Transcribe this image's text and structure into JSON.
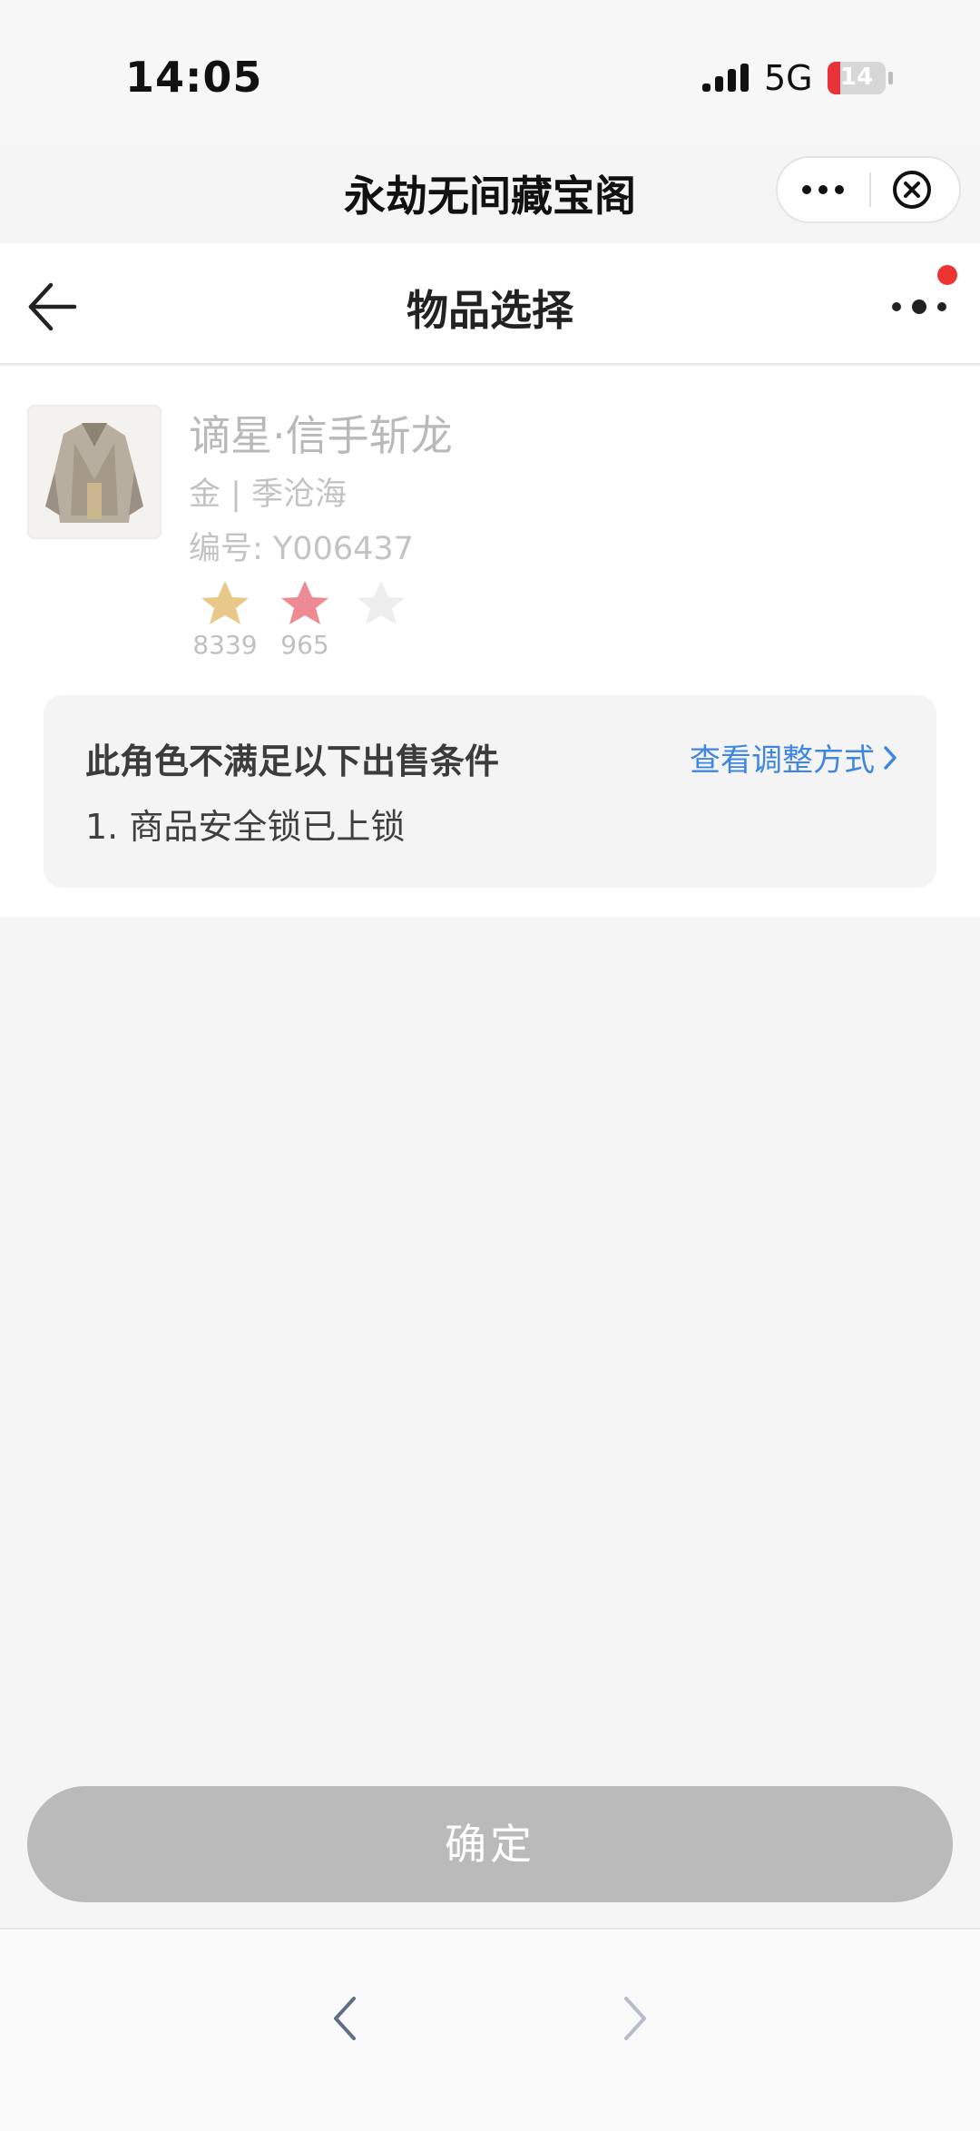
{
  "status_bar": {
    "time": "14:05",
    "network": "5G",
    "battery": "14"
  },
  "mini_program": {
    "title": "永劫无间藏宝阁"
  },
  "header": {
    "title": "物品选择"
  },
  "item": {
    "name": "谪星·信手斩龙",
    "meta": "金 | 季沧海",
    "id_text": "编号: Y006437",
    "stats": [
      "8339",
      "965"
    ],
    "star_colors": [
      "#e9c98a",
      "#ee8a93",
      "#ededed"
    ]
  },
  "notice": {
    "title": "此角色不满足以下出售条件",
    "link": "查看调整方式",
    "items": [
      "1. 商品安全锁已上锁"
    ]
  },
  "confirm_label": "确定",
  "colors": {
    "accent": "#3f86e0",
    "badge": "#ee3333",
    "battery_low": "#e8333a"
  }
}
